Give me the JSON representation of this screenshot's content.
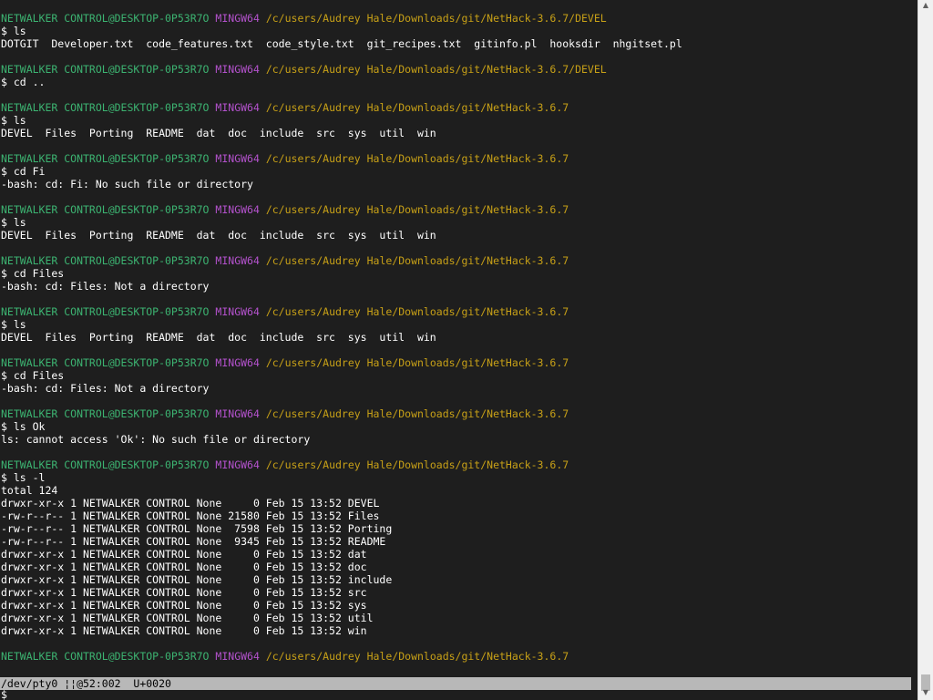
{
  "colors": {
    "background": "#1e1e1e",
    "text": "#ffffff",
    "user_host": "#3cb371",
    "mingw": "#b452cd",
    "path": "#c7a017",
    "status_bar": "#b8b8b8"
  },
  "terminal": {
    "lines": [
      {
        "type": "prompt",
        "user": "NETWALKER CONTROL@DESKTOP-0P53R7O",
        "sys": "MINGW64",
        "path": "/c/users/Audrey Hale/Downloads/git/NetHack-3.6.7/DEVEL"
      },
      {
        "type": "text",
        "text": "$ ls"
      },
      {
        "type": "text",
        "text": "DOTGIT  Developer.txt  code_features.txt  code_style.txt  git_recipes.txt  gitinfo.pl  hooksdir  nhgitset.pl"
      },
      {
        "type": "text",
        "text": ""
      },
      {
        "type": "prompt",
        "user": "NETWALKER CONTROL@DESKTOP-0P53R7O",
        "sys": "MINGW64",
        "path": "/c/users/Audrey Hale/Downloads/git/NetHack-3.6.7/DEVEL"
      },
      {
        "type": "text",
        "text": "$ cd .."
      },
      {
        "type": "text",
        "text": ""
      },
      {
        "type": "prompt",
        "user": "NETWALKER CONTROL@DESKTOP-0P53R7O",
        "sys": "MINGW64",
        "path": "/c/users/Audrey Hale/Downloads/git/NetHack-3.6.7"
      },
      {
        "type": "text",
        "text": "$ ls"
      },
      {
        "type": "text",
        "text": "DEVEL  Files  Porting  README  dat  doc  include  src  sys  util  win"
      },
      {
        "type": "text",
        "text": ""
      },
      {
        "type": "prompt",
        "user": "NETWALKER CONTROL@DESKTOP-0P53R7O",
        "sys": "MINGW64",
        "path": "/c/users/Audrey Hale/Downloads/git/NetHack-3.6.7"
      },
      {
        "type": "text",
        "text": "$ cd Fi"
      },
      {
        "type": "text",
        "text": "-bash: cd: Fi: No such file or directory"
      },
      {
        "type": "text",
        "text": ""
      },
      {
        "type": "prompt",
        "user": "NETWALKER CONTROL@DESKTOP-0P53R7O",
        "sys": "MINGW64",
        "path": "/c/users/Audrey Hale/Downloads/git/NetHack-3.6.7"
      },
      {
        "type": "text",
        "text": "$ ls"
      },
      {
        "type": "text",
        "text": "DEVEL  Files  Porting  README  dat  doc  include  src  sys  util  win"
      },
      {
        "type": "text",
        "text": ""
      },
      {
        "type": "prompt",
        "user": "NETWALKER CONTROL@DESKTOP-0P53R7O",
        "sys": "MINGW64",
        "path": "/c/users/Audrey Hale/Downloads/git/NetHack-3.6.7"
      },
      {
        "type": "text",
        "text": "$ cd Files"
      },
      {
        "type": "text",
        "text": "-bash: cd: Files: Not a directory"
      },
      {
        "type": "text",
        "text": ""
      },
      {
        "type": "prompt",
        "user": "NETWALKER CONTROL@DESKTOP-0P53R7O",
        "sys": "MINGW64",
        "path": "/c/users/Audrey Hale/Downloads/git/NetHack-3.6.7"
      },
      {
        "type": "text",
        "text": "$ ls"
      },
      {
        "type": "text",
        "text": "DEVEL  Files  Porting  README  dat  doc  include  src  sys  util  win"
      },
      {
        "type": "text",
        "text": ""
      },
      {
        "type": "prompt",
        "user": "NETWALKER CONTROL@DESKTOP-0P53R7O",
        "sys": "MINGW64",
        "path": "/c/users/Audrey Hale/Downloads/git/NetHack-3.6.7"
      },
      {
        "type": "text",
        "text": "$ cd Files"
      },
      {
        "type": "text",
        "text": "-bash: cd: Files: Not a directory"
      },
      {
        "type": "text",
        "text": ""
      },
      {
        "type": "prompt",
        "user": "NETWALKER CONTROL@DESKTOP-0P53R7O",
        "sys": "MINGW64",
        "path": "/c/users/Audrey Hale/Downloads/git/NetHack-3.6.7"
      },
      {
        "type": "text",
        "text": "$ ls Ok"
      },
      {
        "type": "text",
        "text": "ls: cannot access 'Ok': No such file or directory"
      },
      {
        "type": "text",
        "text": ""
      },
      {
        "type": "prompt",
        "user": "NETWALKER CONTROL@DESKTOP-0P53R7O",
        "sys": "MINGW64",
        "path": "/c/users/Audrey Hale/Downloads/git/NetHack-3.6.7"
      },
      {
        "type": "text",
        "text": "$ ls -l"
      },
      {
        "type": "text",
        "text": "total 124"
      },
      {
        "type": "text",
        "text": "drwxr-xr-x 1 NETWALKER CONTROL None     0 Feb 15 13:52 DEVEL"
      },
      {
        "type": "text",
        "text": "-rw-r--r-- 1 NETWALKER CONTROL None 21580 Feb 15 13:52 Files"
      },
      {
        "type": "text",
        "text": "-rw-r--r-- 1 NETWALKER CONTROL None  7598 Feb 15 13:52 Porting"
      },
      {
        "type": "text",
        "text": "-rw-r--r-- 1 NETWALKER CONTROL None  9345 Feb 15 13:52 README"
      },
      {
        "type": "text",
        "text": "drwxr-xr-x 1 NETWALKER CONTROL None     0 Feb 15 13:52 dat"
      },
      {
        "type": "text",
        "text": "drwxr-xr-x 1 NETWALKER CONTROL None     0 Feb 15 13:52 doc"
      },
      {
        "type": "text",
        "text": "drwxr-xr-x 1 NETWALKER CONTROL None     0 Feb 15 13:52 include"
      },
      {
        "type": "text",
        "text": "drwxr-xr-x 1 NETWALKER CONTROL None     0 Feb 15 13:52 src"
      },
      {
        "type": "text",
        "text": "drwxr-xr-x 1 NETWALKER CONTROL None     0 Feb 15 13:52 sys"
      },
      {
        "type": "text",
        "text": "drwxr-xr-x 1 NETWALKER CONTROL None     0 Feb 15 13:52 util"
      },
      {
        "type": "text",
        "text": "drwxr-xr-x 1 NETWALKER CONTROL None     0 Feb 15 13:52 win"
      },
      {
        "type": "text",
        "text": ""
      },
      {
        "type": "prompt",
        "user": "NETWALKER CONTROL@DESKTOP-0P53R7O",
        "sys": "MINGW64",
        "path": "/c/users/Audrey Hale/Downloads/git/NetHack-3.6.7"
      }
    ]
  },
  "status_bar": {
    "text": "/dev/pty0 ¦¦@52:002  U+0020"
  },
  "input_line": {
    "text": "$"
  },
  "scrollbar": {
    "up_icon": "arrow-up-icon",
    "down_icon": "arrow-down-icon"
  }
}
